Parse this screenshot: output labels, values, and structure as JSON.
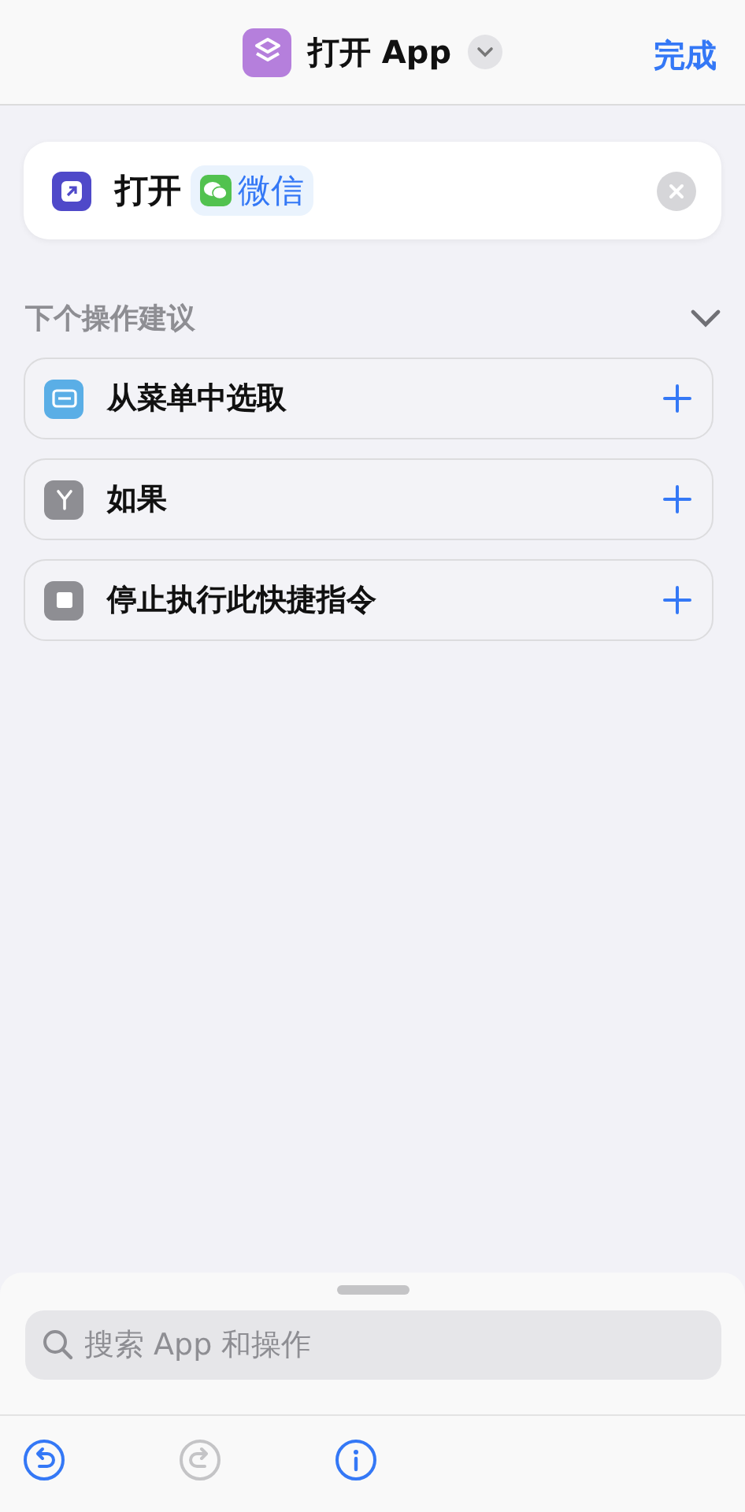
{
  "header": {
    "title": "打开 App",
    "done": "完成"
  },
  "action": {
    "verb": "打开",
    "app": "微信"
  },
  "suggestions": {
    "title": "下个操作建议",
    "expanded": true,
    "items": [
      {
        "kind": "menu",
        "label": "从菜单中选取",
        "color": "#5aaee6"
      },
      {
        "kind": "if",
        "label": "如果",
        "color": "#8e8e93"
      },
      {
        "kind": "stop",
        "label": "停止执行此快捷指令",
        "color": "#8e8e93"
      }
    ]
  },
  "search": {
    "placeholder": "搜索 App 和操作"
  },
  "toolbar": [
    {
      "kind": "undo",
      "disabled": false
    },
    {
      "kind": "redo",
      "disabled": true
    },
    {
      "kind": "info",
      "disabled": false
    }
  ]
}
